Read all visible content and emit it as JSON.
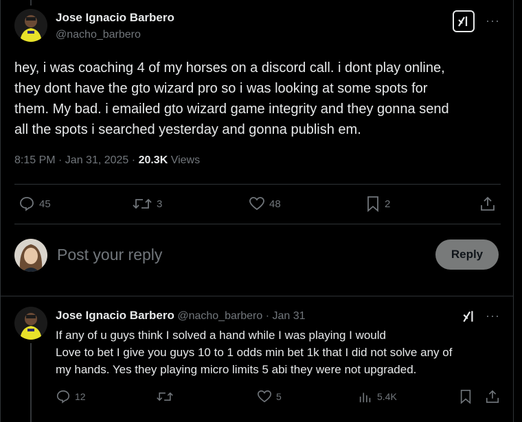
{
  "tweet": {
    "author_name": "Jose Ignacio Barbero",
    "author_handle": "@nacho_barbero",
    "text_lines": [
      "hey, i was coaching 4 of my horses on a discord call. i dont play online,",
      "they dont have the gto wizard pro so i was looking at some spots for",
      "them. My bad. i emailed gto wizard game integrity and they gonna send",
      "all the spots i searched yesterday and gonna publish em."
    ],
    "time": "8:15 PM · Jan 31, 2025 ·",
    "views_count": "20.3K",
    "views_label": "Views",
    "stats": {
      "replies": "45",
      "reposts": "3",
      "likes": "48",
      "bookmarks": "2"
    }
  },
  "composer": {
    "placeholder": "Post your reply",
    "button": "Reply"
  },
  "reply": {
    "author_name": "Jose Ignacio Barbero",
    "author_handle": "@nacho_barbero",
    "date": "· Jan 31",
    "text_lines": [
      "If any of u guys think I solved a hand while I was playing I would",
      "Love to bet I give you guys 10 to 1 odds min bet 1k that I did not solve any of",
      "my hands. Yes they playing micro limits 5 abi they were not upgraded."
    ],
    "stats": {
      "replies": "12",
      "likes": "5",
      "views": "5.4K"
    }
  },
  "colors": {
    "background": "#000000",
    "text": "#e7e9ea",
    "muted": "#71767b",
    "divider": "#2f3336",
    "reply_button": "#787a7a",
    "avatar_shirt": "#e8e22a"
  }
}
